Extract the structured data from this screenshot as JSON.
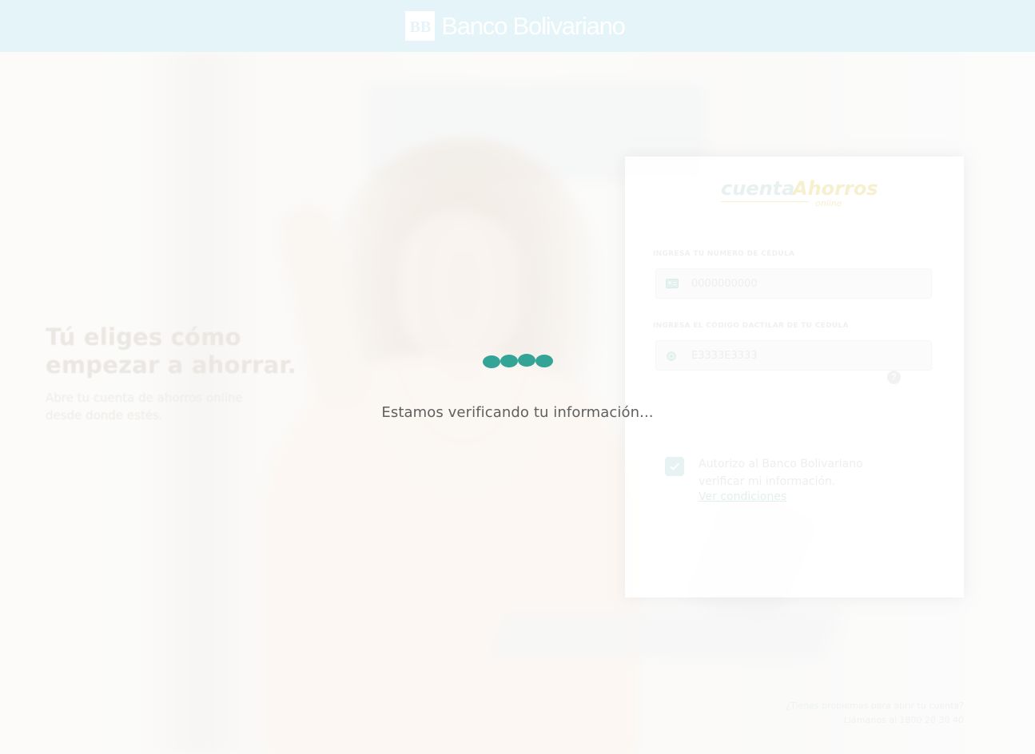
{
  "header": {
    "brand_name": "Banco Bolivariano",
    "brand_mark": "BB",
    "background_color": "#e5f4f8"
  },
  "hero": {
    "title_line1": "Tú eliges cómo",
    "title_line2": "empezar a ahorrar.",
    "subtitle_line1": "Abre tu cuenta de ahorros online",
    "subtitle_line2": "desde donde estés."
  },
  "card": {
    "logo_part1": "cuenta",
    "logo_part2": "Ahorros",
    "logo_part3": "online",
    "id_label": "INGRESA TU NÚMERO DE CÉDULA",
    "id_placeholder": "0000000000",
    "id_icon": "id-card-icon",
    "code_label": "INGRESA EL CÓDIGO DACTILAR DE TU CÉDULA",
    "code_placeholder": "E3333E3333",
    "code_icon": "fingerprint-icon",
    "help_icon": "question-icon",
    "consent_checked": true,
    "consent_line1": "Autorizo al Banco Bolivariano",
    "consent_line2": "verificar mi información.",
    "consent_link": "Ver condiciones"
  },
  "footer": {
    "line1": "¿Tienes problemas para abrir tu cuenta?",
    "line2": "Llámanos al 1800 20 30 40"
  },
  "loader": {
    "message": "Estamos verificando tu información...",
    "dot_color": "#34a497"
  }
}
